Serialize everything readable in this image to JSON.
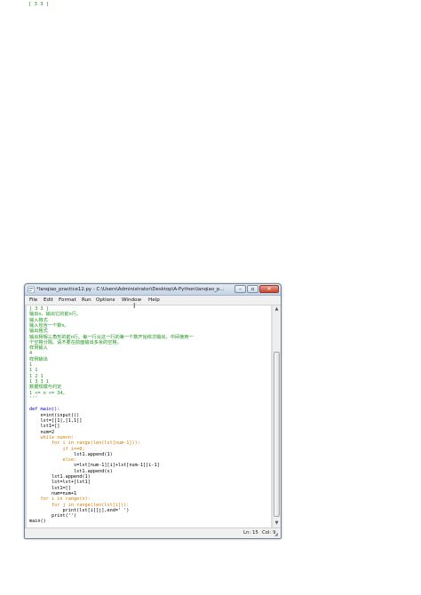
{
  "page_text": {
    "lines": [
      "[ 3 3 ]"
    ]
  },
  "window": {
    "title": "*lanqiao_practice12.py - C:\\Users\\Administrator\\Desktop\\A-Python\\lanqiao_pr...",
    "controls": {
      "minimize": "–",
      "maximize": "▫",
      "close": "✕"
    },
    "menu": [
      "File",
      "Edit",
      "Format",
      "Run",
      "Options",
      "Window",
      "Help"
    ],
    "status": {
      "line": "Ln: 15",
      "col": "Col: 9"
    },
    "icons": {
      "app": "python-idle-icon",
      "resize": "resize-grip-icon"
    }
  },
  "code_lines": [
    {
      "text": "[ 3 3 ]",
      "style": "doc"
    },
    {
      "text": "输出n，输出它的前n行。",
      "style": "doc"
    },
    {
      "text": "输入格式",
      "style": "doc"
    },
    {
      "text": "输入包含一个数n。",
      "style": "doc"
    },
    {
      "text": "输出格式",
      "style": "doc"
    },
    {
      "text": "输出杨辉三角形的前n行。每一行从这一行的第一个数开始依次输出，中间使用一",
      "style": "doc"
    },
    {
      "text": "个空格分隔。请不要在前面输出多余的空格。",
      "style": "doc"
    },
    {
      "text": "样例输入",
      "style": "doc"
    },
    {
      "text": "4",
      "style": "doc"
    },
    {
      "text": "样例输出",
      "style": "doc"
    },
    {
      "text": "1",
      "style": "doc"
    },
    {
      "text": "1 1",
      "style": "doc"
    },
    {
      "text": "1 2 1",
      "style": "doc"
    },
    {
      "text": "1 3 3 1",
      "style": "doc"
    },
    {
      "text": "数据规模与约定",
      "style": "doc"
    },
    {
      "text": "1 <= n <= 34。",
      "style": "doc"
    },
    {
      "text": "'''",
      "style": "doc"
    },
    {
      "text": "",
      "style": "plain"
    },
    {
      "text": "def main():",
      "style": "def"
    },
    {
      "text": "    n=int(input())",
      "style": "plain"
    },
    {
      "text": "    lst=[[1],[1,1]]",
      "style": "plain"
    },
    {
      "text": "    lst1=[]",
      "style": "plain"
    },
    {
      "text": "    num=2",
      "style": "plain"
    },
    {
      "text": "    while num<n:",
      "style": "kw"
    },
    {
      "text": "        for i in range(len(lst[num-1])):",
      "style": "kw"
    },
    {
      "text": "            if i==0:",
      "style": "kw"
    },
    {
      "text": "                lst1.append(1)",
      "style": "plain"
    },
    {
      "text": "            else:",
      "style": "kw"
    },
    {
      "text": "                s=lst[num-1][i]+lst[num-1][i-1]",
      "style": "plain"
    },
    {
      "text": "                lst1.append(s)",
      "style": "plain"
    },
    {
      "text": "        lst1.append(1)",
      "style": "plain"
    },
    {
      "text": "        lst=lst+[lst1]",
      "style": "plain"
    },
    {
      "text": "        lst1=[]",
      "style": "plain"
    },
    {
      "text": "        num=num+1",
      "style": "plain"
    },
    {
      "text": "    for i in range(n):",
      "style": "kw"
    },
    {
      "text": "        for j in range(len(lst[i])):",
      "style": "kw"
    },
    {
      "text": "            print(lst[i][j],end=' ')",
      "style": "plain"
    },
    {
      "text": "        print('')",
      "style": "plain"
    },
    {
      "text": "main()",
      "style": "plain"
    }
  ]
}
